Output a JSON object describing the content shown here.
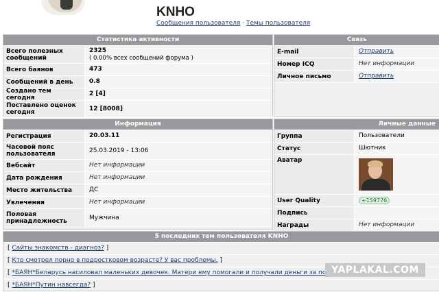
{
  "profile": {
    "username": "KNHO",
    "link_posts": "Сообщения пользователя",
    "separator": "·",
    "link_topics": "Темы пользователя"
  },
  "activity": {
    "title": "Статистика активности",
    "rows": [
      {
        "label": "Всего полезных сообщений",
        "value": "2325",
        "sub": "( 0.00% всех сообщений форума )"
      },
      {
        "label": "Всего баянов",
        "value": "473"
      },
      {
        "label": "Сообщений в день",
        "value": "0.8"
      },
      {
        "label": "Создано тем сегодня",
        "value": "2 [4]"
      },
      {
        "label": "Поставлено оценок сегодня",
        "value": "12 [8008]"
      }
    ]
  },
  "contact": {
    "title": "Связь",
    "rows": [
      {
        "label": "E-mail",
        "value": "Отправить"
      },
      {
        "label": "Номер ICQ",
        "value": "Нет информации"
      },
      {
        "label": "Личное письмо",
        "value": "Отправить"
      }
    ]
  },
  "info": {
    "title": "Информация",
    "rows": [
      {
        "label": "Регистрация",
        "value": "20.03.11"
      },
      {
        "label": "Часовой пояс пользователя",
        "value": "25.03.2019 - 13:06"
      },
      {
        "label": "Вебсайт",
        "value": "Нет информации"
      },
      {
        "label": "Дата рождения",
        "value": "Нет информации"
      },
      {
        "label": "Место жительства",
        "value": "ДС"
      },
      {
        "label": "Увлечения",
        "value": "Нет информации"
      },
      {
        "label": "Половая принадлежность",
        "value": "Мужчина"
      }
    ]
  },
  "personal": {
    "title": "Личные данные",
    "rows": [
      {
        "label": "Группа",
        "value": "Пользователи"
      },
      {
        "label": "Статус",
        "value": "Шютник"
      },
      {
        "label": "Аватар",
        "value": ""
      },
      {
        "label": "User Quality",
        "value": "+159776"
      },
      {
        "label": "Подпись",
        "value": ""
      },
      {
        "label": "Награды",
        "value": "Нет информации"
      }
    ]
  },
  "topics": {
    "title": "5 последних тем пользователя KNHO",
    "items": [
      "Сайты знакомств - диагноз?",
      "Кто смотрел порно в подростковом возрасте? У вас проблемы.",
      "*БАЯН*Беларусь насиловал маленьких девочек. Матери ему помогали и получали деньги за порно.",
      "*БАЯН*Путин навсегда?"
    ],
    "open": "[",
    "close": "]"
  },
  "watermark": "YAPLAKAL.COM"
}
